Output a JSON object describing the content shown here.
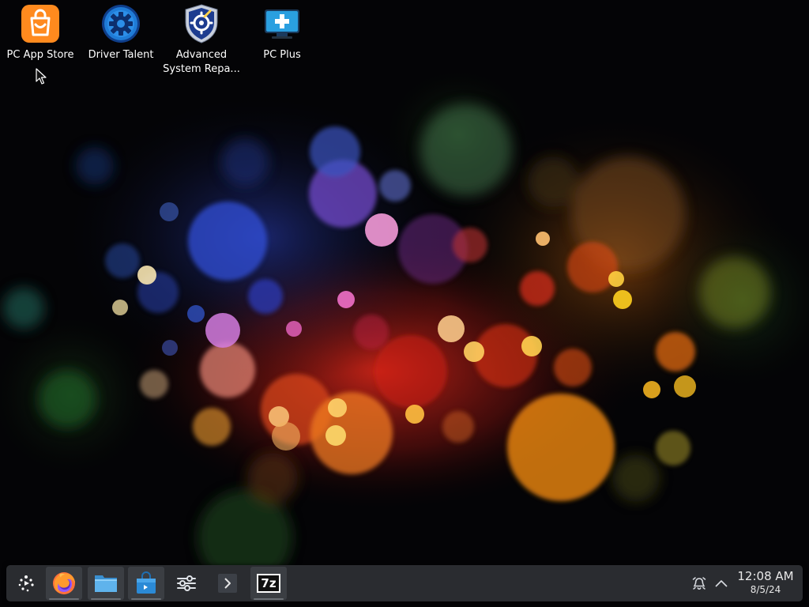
{
  "desktop": {
    "icons": [
      {
        "label": "PC App Store",
        "icon": "shopping-bag-icon",
        "color": "#ff8a1e"
      },
      {
        "label": "Driver Talent",
        "icon": "gear-icon",
        "color": "#1f7bd6"
      },
      {
        "label": "Advanced System Repa...",
        "label_line1": "Advanced",
        "label_line2": "System Repa...",
        "icon": "shield-icon",
        "color": "#1d3c8f"
      },
      {
        "label": "PC Plus",
        "icon": "medical-monitor-icon",
        "color": "#2a9fe0"
      }
    ]
  },
  "taskbar": {
    "launcher_icon": "app-launcher-icon",
    "pinned": [
      {
        "name": "Firefox",
        "icon": "firefox-icon",
        "active": true
      },
      {
        "name": "Files",
        "icon": "folder-icon",
        "active": true
      },
      {
        "name": "Discover",
        "icon": "store-bag-icon",
        "active": true
      },
      {
        "name": "System Settings",
        "icon": "sliders-icon",
        "active": false
      },
      {
        "name": "Terminal",
        "icon": "terminal-icon",
        "active": false
      },
      {
        "name": "7-Zip",
        "icon": "7zip-icon",
        "icon_text": "7z",
        "active": true
      }
    ],
    "tray": {
      "icons": [
        "alarm-icon",
        "expand-tray-icon"
      ],
      "time": "12:08 AM",
      "date": "8/5/24"
    }
  },
  "colors": {
    "taskbar_bg": "#2a2c30",
    "desktop_bg": "#050508",
    "text": "#ffffff"
  }
}
